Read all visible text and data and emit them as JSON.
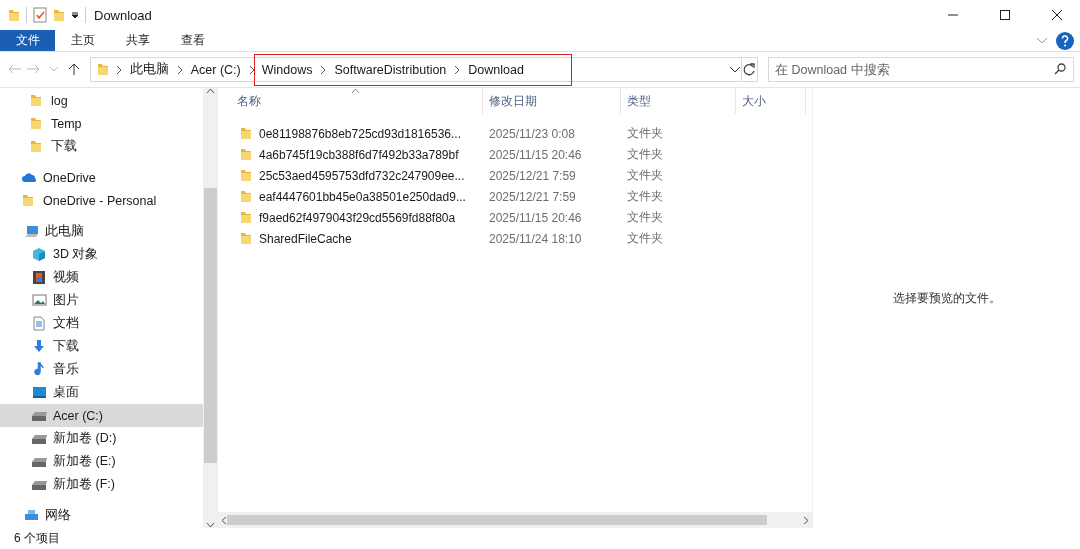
{
  "window": {
    "title": "Download"
  },
  "ribbon_tabs": [
    {
      "label": "文件",
      "selected": true
    },
    {
      "label": "主页",
      "selected": false
    },
    {
      "label": "共享",
      "selected": false
    },
    {
      "label": "查看",
      "selected": false
    }
  ],
  "breadcrumb": [
    {
      "kind": "crumb",
      "label": "此电脑"
    },
    {
      "kind": "crumb",
      "label": "Acer (C:)"
    },
    {
      "kind": "highlight",
      "items": [
        {
          "kind": "crumb",
          "label": "Windows"
        },
        {
          "kind": "crumb",
          "label": "SoftwareDistribution"
        },
        {
          "kind": "crumb",
          "label": "Download"
        }
      ]
    }
  ],
  "search": {
    "placeholder": "在 Download 中搜索"
  },
  "sidebar": {
    "items": [
      {
        "label": "log",
        "kind": "folder",
        "selected": false
      },
      {
        "label": "Temp",
        "kind": "folder",
        "selected": false
      },
      {
        "label": "下载",
        "kind": "folder",
        "selected": false
      },
      {
        "label": "OneDrive",
        "kind": "cloud",
        "selected": false
      },
      {
        "label": "OneDrive - Personal",
        "kind": "folder",
        "selected": false
      },
      {
        "label": "此电脑",
        "kind": "pc",
        "selected": false,
        "children": [
          {
            "label": "3D 对象",
            "kind": "cube",
            "selected": false
          },
          {
            "label": "视频",
            "kind": "video",
            "selected": false
          },
          {
            "label": "图片",
            "kind": "image",
            "selected": false
          },
          {
            "label": "文档",
            "kind": "doc",
            "selected": false
          },
          {
            "label": "下载",
            "kind": "download",
            "selected": false
          },
          {
            "label": "音乐",
            "kind": "music",
            "selected": false
          },
          {
            "label": "桌面",
            "kind": "desktop",
            "selected": false
          },
          {
            "label": "Acer (C:)",
            "kind": "drive",
            "selected": true
          },
          {
            "label": "新加卷 (D:)",
            "kind": "drive",
            "selected": false
          },
          {
            "label": "新加卷 (E:)",
            "kind": "drive",
            "selected": false
          },
          {
            "label": "新加卷 (F:)",
            "kind": "drive",
            "selected": false
          }
        ]
      },
      {
        "label": "网络",
        "kind": "network",
        "selected": false
      }
    ]
  },
  "table": {
    "columns": [
      "名称",
      "修改日期",
      "类型",
      "大小"
    ],
    "rows": [
      [
        "0e81198876b8eb725cd93d1816536...",
        "2025/11/23 0:08",
        "文件夹"
      ],
      [
        "4a6b745f19cb388f6d7f492b33a789bf",
        "2025/11/15 20:46",
        "文件夹"
      ],
      [
        "25c53aed4595753dfd732c247909ee...",
        "2025/12/21 7:59",
        "文件夹"
      ],
      [
        "eaf4447601bb45e0a38501e250dad9...",
        "2025/12/21 7:59",
        "文件夹"
      ],
      [
        "f9aed62f4979043f29cd5569fd88f80a",
        "2025/11/15 20:46",
        "文件夹"
      ],
      [
        "SharedFileCache",
        "2025/11/24 18:10",
        "文件夹"
      ]
    ]
  },
  "preview": {
    "message": "选择要预览的文件。"
  },
  "status_bar": {
    "item_count": "6 个项目"
  }
}
